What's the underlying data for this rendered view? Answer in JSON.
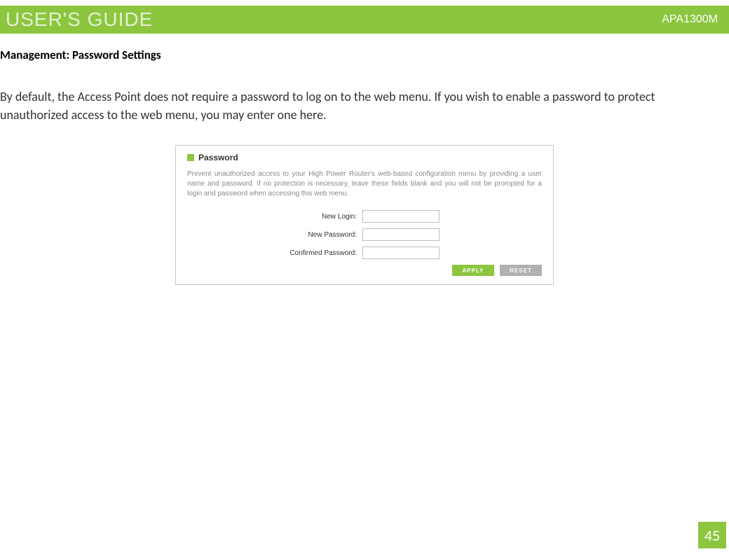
{
  "header": {
    "left_title": "USER'S GUIDE",
    "right_model": "APA1300M"
  },
  "page": {
    "title": "Management: Password Settings",
    "description": "By default, the Access Point does not require a password to log on to the web menu. If you wish to enable a password to protect unauthorized access to the web menu, you may enter one here.",
    "number": "45"
  },
  "panel": {
    "header_title": "Password",
    "description": "Prevent unauthorized access to your High Power Router's web-based configuration menu by providing a user name and password. If no protection is necessary, leave these fields blank and you will not be prompted for a login and password when accessing this web menu.",
    "fields": [
      {
        "label": "New Login:",
        "value": ""
      },
      {
        "label": "New Password:",
        "value": ""
      },
      {
        "label": "Confirmed Password:",
        "value": ""
      }
    ],
    "buttons": {
      "apply": "APPLY",
      "reset": "RESET"
    }
  }
}
